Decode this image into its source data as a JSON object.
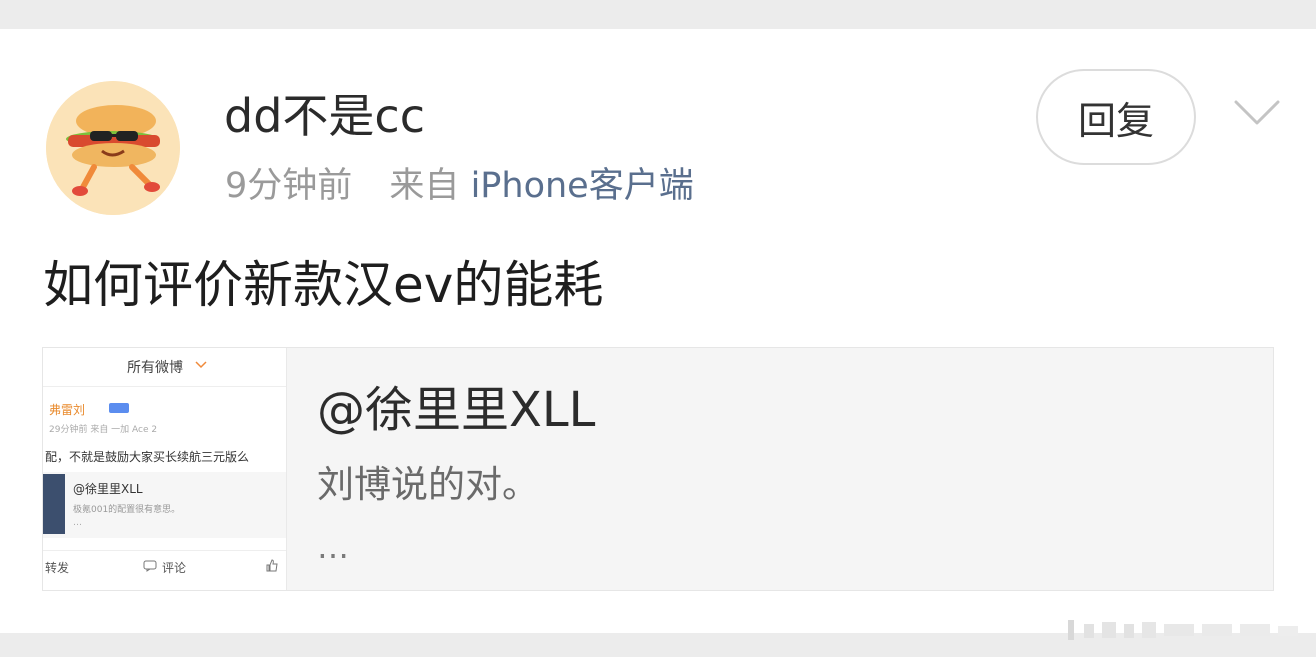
{
  "post": {
    "username": "dd不是cc",
    "time": "9分钟前",
    "from_label": "来自",
    "client": "iPhone客户端",
    "reply_label": "回复",
    "text": "如何评价新款汉ev的能耗"
  },
  "quote": {
    "user": "@徐里里XLL",
    "text": "刘博说的对。",
    "ellipsis": "…",
    "thumb": {
      "filter_label": "所有微博",
      "name": "弗雷刘",
      "meta": "29分钟前  来自 一加 Ace 2",
      "content": "配，不就是鼓励大家买长续航三元版么",
      "quote_user": "@徐里里XLL",
      "quote_text": "极氪001的配置很有意思。",
      "quote_ellipsis": "…",
      "forward": "转发",
      "comment": "评论"
    }
  },
  "colors": {
    "client_link": "#5a6f8e",
    "meta_gray": "#9a9a9a",
    "quote_bg": "#f5f5f5"
  },
  "icons": {
    "chevron": "chevron-down-icon",
    "avatar": "sandwich-avatar"
  }
}
